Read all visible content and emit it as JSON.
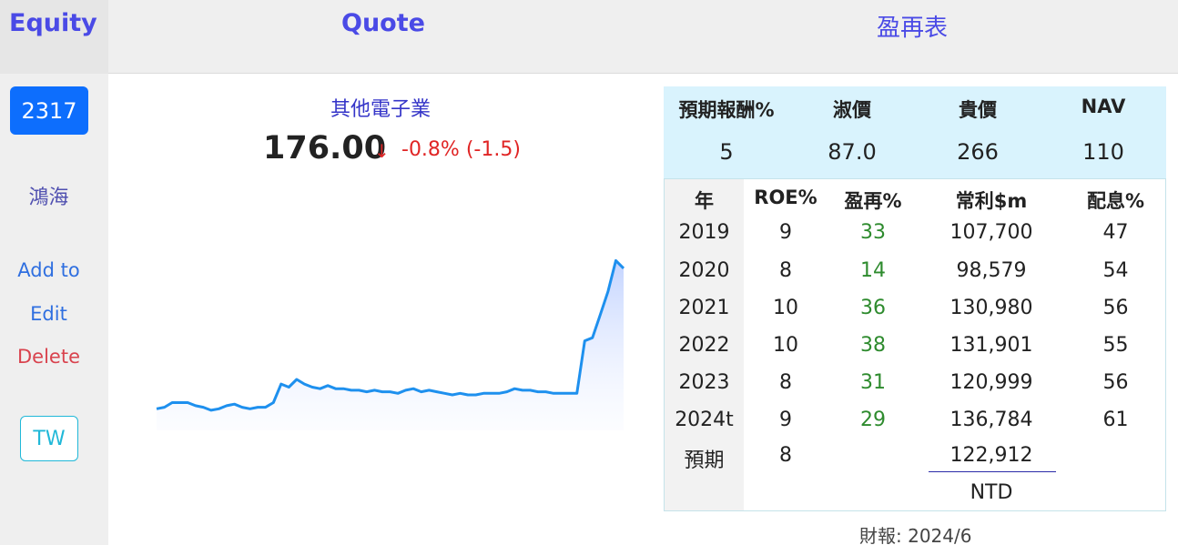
{
  "header": {
    "equity_title": "Equity",
    "quote_title": "Quote",
    "pe_title": "盈再表"
  },
  "sidebar": {
    "stock_code": "2317",
    "stock_name": "鴻海",
    "add_label": "Add to",
    "edit_label": "Edit",
    "delete_label": "Delete",
    "market_label": "TW"
  },
  "quote": {
    "industry": "其他電子業",
    "price": "176.00",
    "arrow": "↓",
    "change": "-0.8% (-1.5)",
    "line_color": "#1e90ee",
    "chart_data": {
      "type": "area",
      "series": [
        {
          "values": [
            54,
            55,
            58,
            58,
            58,
            56,
            55,
            53,
            54,
            56,
            57,
            55,
            54,
            55,
            55,
            58,
            70,
            68,
            73,
            70,
            68,
            67,
            69,
            67,
            67,
            66,
            66,
            65,
            66,
            65,
            65,
            64,
            66,
            67,
            65,
            66,
            65,
            64,
            63,
            64,
            63,
            63,
            64,
            64,
            64,
            65,
            67,
            66,
            66,
            65,
            65,
            64,
            64,
            64,
            64,
            98,
            100,
            115,
            130,
            150,
            145
          ]
        }
      ],
      "grid": false
    }
  },
  "pe_table": {
    "top_headers": [
      "預期報酬%",
      "淑價",
      "貴價",
      "NAV"
    ],
    "top_values": [
      "5",
      "87.0",
      "266",
      "110"
    ],
    "col_headers": [
      "年",
      "ROE%",
      "盈再%",
      "常利$m",
      "配息%"
    ],
    "rows": [
      {
        "year": "2019",
        "roe": "9",
        "pe": "33",
        "profit": "107,700",
        "div": "47"
      },
      {
        "year": "2020",
        "roe": "8",
        "pe": "14",
        "profit": "98,579",
        "div": "54"
      },
      {
        "year": "2021",
        "roe": "10",
        "pe": "36",
        "profit": "130,980",
        "div": "56"
      },
      {
        "year": "2022",
        "roe": "10",
        "pe": "38",
        "profit": "131,901",
        "div": "55"
      },
      {
        "year": "2023",
        "roe": "8",
        "pe": "31",
        "profit": "120,999",
        "div": "56"
      },
      {
        "year": "2024t",
        "roe": "9",
        "pe": "29",
        "profit": "136,784",
        "div": "61"
      }
    ],
    "forecast": {
      "label": "預期",
      "roe": "8",
      "profit": "122,912"
    },
    "currency": "NTD",
    "report_date": "財報: 2024/6"
  }
}
